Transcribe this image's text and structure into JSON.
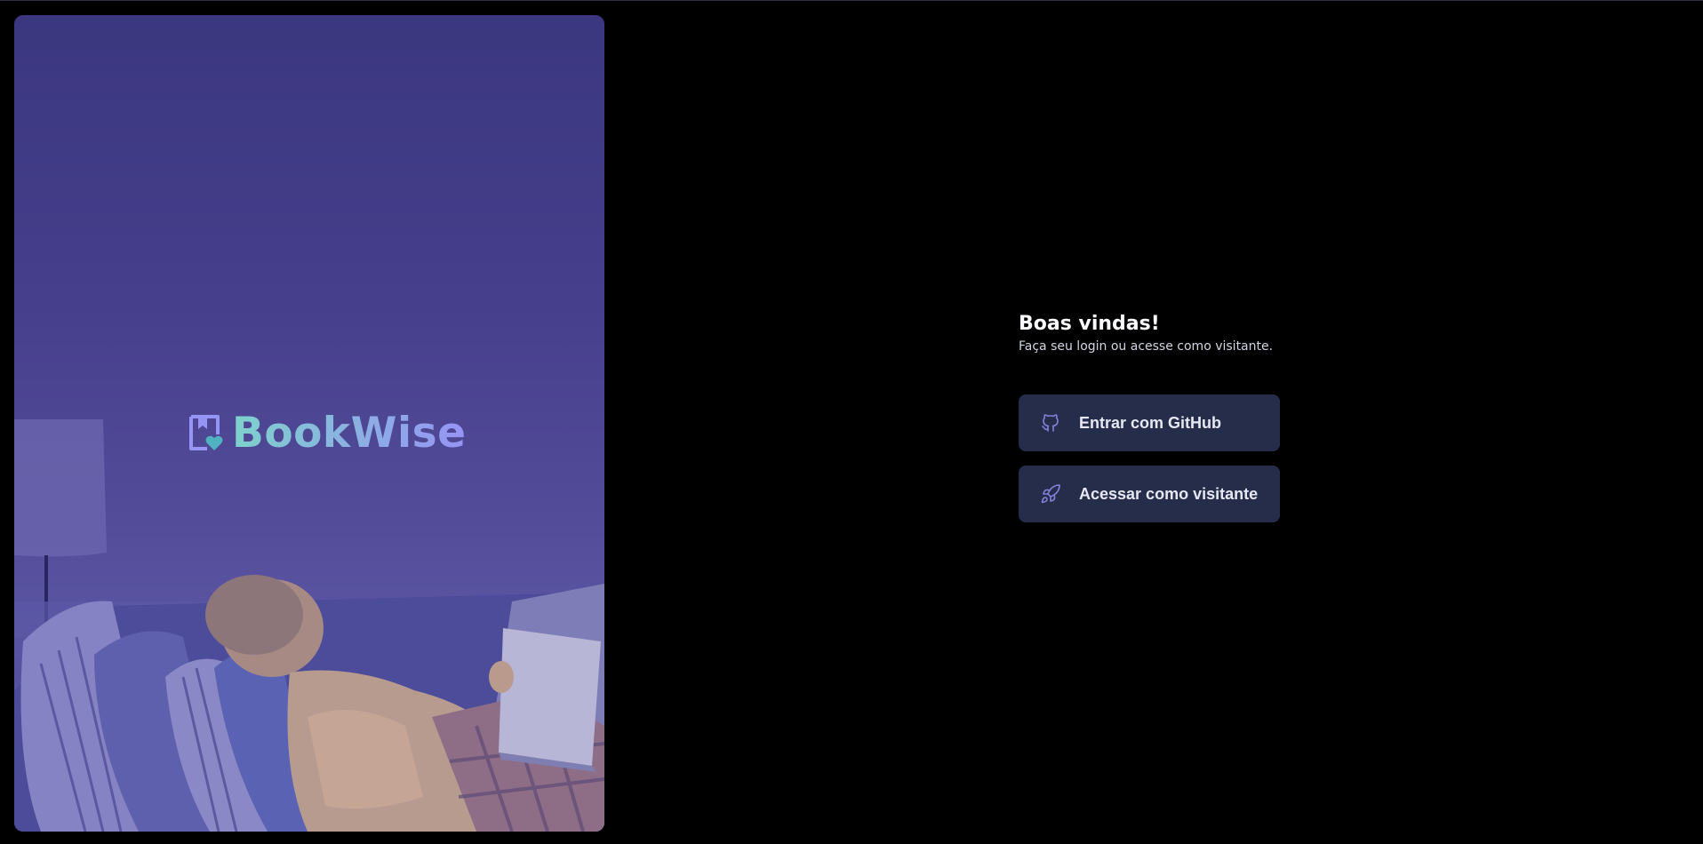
{
  "brand": {
    "name": "BookWise",
    "accent_gradient": [
      "#7fd1cc",
      "#9694f5"
    ]
  },
  "hero": {
    "illustration": "woman-reading-on-couch",
    "overlay_color": "#4a4494"
  },
  "login": {
    "title": "Boas vindas!",
    "subtitle": "Faça seu login ou acesse como visitante.",
    "buttons": [
      {
        "label": "Entrar com GitHub",
        "icon": "github-icon"
      },
      {
        "label": "Acessar como visitante",
        "icon": "rocket-icon"
      }
    ]
  },
  "colors": {
    "background": "#000000",
    "button_bg": "#252d4a",
    "icon_color": "#8381d9"
  }
}
